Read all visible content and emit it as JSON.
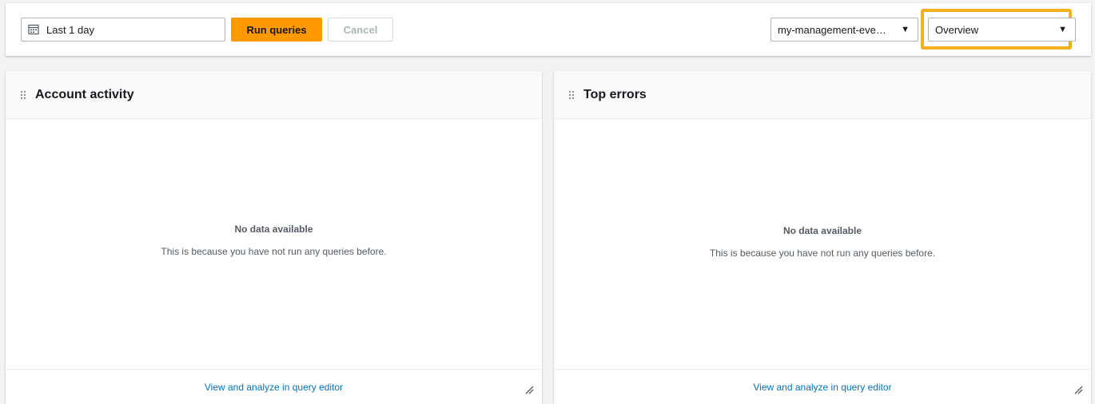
{
  "toolbar": {
    "date_range": "Last 1 day",
    "run_label": "Run queries",
    "cancel_label": "Cancel",
    "event_data_store": "my-management-eve…",
    "dashboard": "Overview",
    "accent_color": "#ff9900",
    "highlight_color": "#f2b01e"
  },
  "panels": [
    {
      "title": "Account activity",
      "empty_title": "No data available",
      "empty_message": "This is because you have not run any queries before.",
      "footer_link": "View and analyze in query editor"
    },
    {
      "title": "Top errors",
      "empty_title": "No data available",
      "empty_message": "This is because you have not run any queries before.",
      "footer_link": "View and analyze in query editor"
    }
  ],
  "icons": {
    "calendar": "calendar-icon",
    "caret": "caret-down-icon",
    "drag": "drag-handle-icon",
    "resize": "resize-handle-icon"
  }
}
